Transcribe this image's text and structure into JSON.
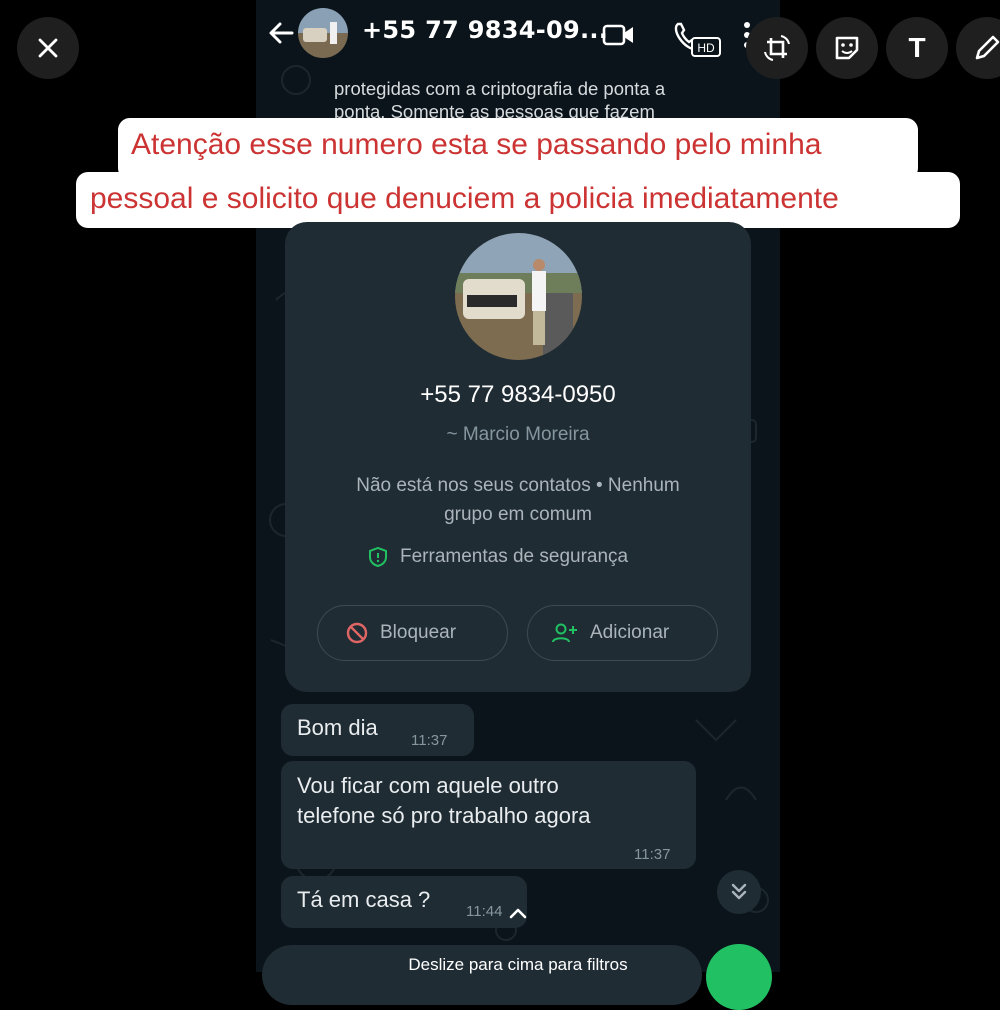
{
  "editor": {
    "close_icon": "close-icon",
    "tools": [
      "crop-rotate-icon",
      "sticker-icon",
      "text-icon",
      "pencil-icon"
    ],
    "text_tool_label": "T"
  },
  "chat_header": {
    "title": "+55 77 9834-09...",
    "icons": [
      "back-arrow-icon",
      "video-call-icon",
      "hd-call-icon",
      "more-vert-icon"
    ],
    "hd_badge": "HD"
  },
  "encryption_note": {
    "line1": "protegidas com a criptografia de ponta a",
    "line2": "ponta. Somente as pessoas que fazem"
  },
  "banner": {
    "line1": "Atenção esse numero esta se passando pelo minha",
    "line2": "pessoal e solicito que denuciem a policia imediatamente",
    "text_color": "#cc3333"
  },
  "contact_card": {
    "phone": "+55 77 9834-0950",
    "name": "~ Marcio Moreira",
    "info_line1": "Não está nos seus contatos • Nenhum",
    "info_line2": "grupo em comum",
    "security_label": "Ferramentas de segurança",
    "block_label": "Bloquear",
    "add_label": "Adicionar"
  },
  "messages": [
    {
      "text": "Bom dia",
      "time": "11:37"
    },
    {
      "lines": [
        "Vou ficar com aquele outro",
        "telefone só pro trabalho agora"
      ],
      "time": "11:37"
    },
    {
      "text": "Tá em casa ?",
      "time": "11:44"
    }
  ],
  "footer": {
    "swipe_hint": "Deslize para cima para filtros"
  },
  "colors": {
    "chat_bg": "#0b141a",
    "bubble": "#1f2c33",
    "accent_green": "#21c063",
    "danger_red": "#e06666"
  }
}
